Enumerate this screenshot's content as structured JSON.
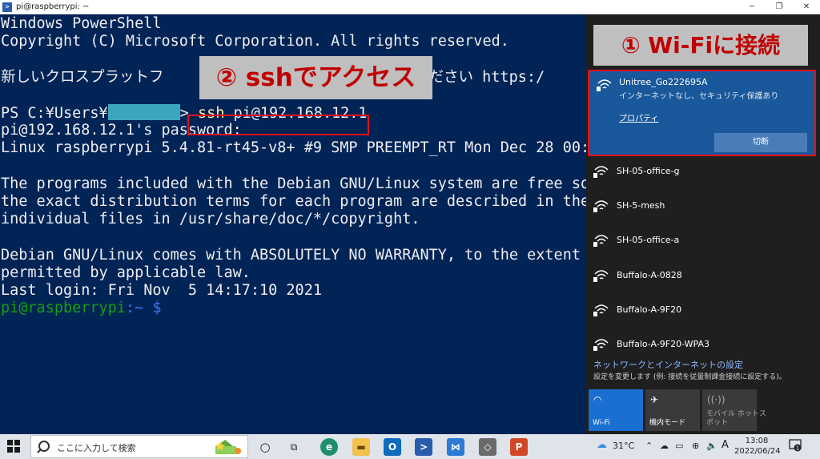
{
  "window": {
    "title": "pi@raspberrypi: ~",
    "minimize": "─",
    "maximize": "❐",
    "close": "✕"
  },
  "terminal": {
    "line1": "Windows PowerShell",
    "line2": "Copyright (C) Microsoft Corporation. All rights reserved.",
    "line3_left": "新しいクロスプラットフ",
    "line3_right": "しください https:/",
    "prompt_prefix": "PS C:¥Users¥",
    "prompt_suffix": ">",
    "ssh_command": "ssh",
    "ssh_target": " pi@192.168.12.1",
    "password_prompt": "pi@192.168.12.1's password:",
    "linux_banner": "Linux raspberrypi 5.4.81-rt45-v8+ #9 SMP PREEMPT_RT Mon Dec 28 00:",
    "debian1": "The programs included with the Debian GNU/Linux system are free so",
    "debian2": "the exact distribution terms for each program are described in the",
    "debian3": "individual files in /usr/share/doc/*/copyright.",
    "warranty1": "Debian GNU/Linux comes with ABSOLUTELY NO WARRANTY, to the extent",
    "warranty2": "permitted by applicable law.",
    "last_login": "Last login: Fri Nov  5 14:17:10 2021",
    "shell_user": "pi@raspberrypi",
    "shell_path": ":~ $"
  },
  "callouts": {
    "step1": "① Wi-Fiに接続",
    "step2": "② sshでアクセス"
  },
  "wifi": {
    "active": {
      "ssid": "Unitree_Go222695A",
      "status": "インターネットなし、セキュリティ保護あり",
      "properties": "プロパティ",
      "disconnect": "切断"
    },
    "networks": [
      {
        "ssid": "SH-05-office-g"
      },
      {
        "ssid": "SH-5-mesh"
      },
      {
        "ssid": "SH-05-office-a"
      },
      {
        "ssid": "Buffalo-A-0828"
      },
      {
        "ssid": "Buffalo-A-9F20"
      },
      {
        "ssid": "Buffalo-A-9F20-WPA3"
      }
    ],
    "settings_link": "ネットワークとインターネットの設定",
    "settings_sub": "設定を変更します (例: 接続を従量制課金接続に設定する)。",
    "tiles": [
      {
        "label": "Wi-Fi",
        "color": "#1a6fd1"
      },
      {
        "label": "機内モード",
        "color": "#3a3a3a"
      },
      {
        "label": "モバイル ホットス\nポット",
        "color": "#3a3a3a"
      }
    ]
  },
  "taskbar": {
    "search_placeholder": "ここに入力して検索",
    "weather": "31°C",
    "ime": "A",
    "time": "13:08",
    "date": "2022/06/24",
    "notification_count": "1"
  }
}
